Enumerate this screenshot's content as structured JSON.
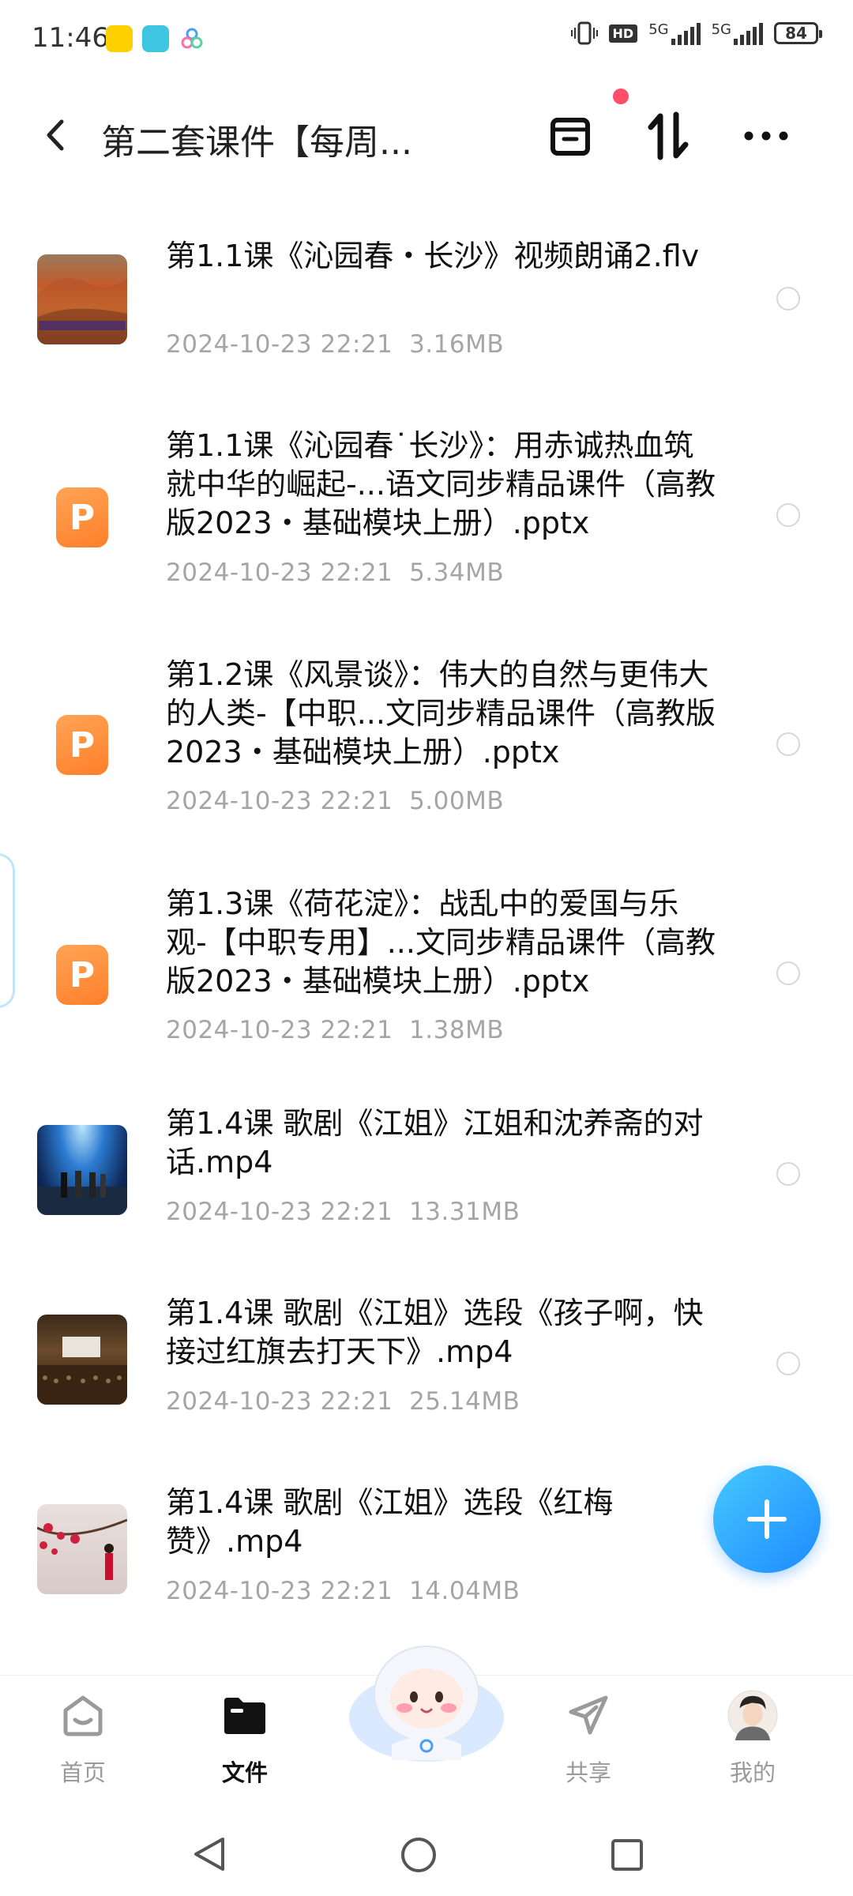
{
  "status_bar": {
    "time": "11:46",
    "network_1": "5G",
    "network_2": "5G",
    "hd_label": "HD",
    "battery": "84"
  },
  "header": {
    "title": "第二套课件【每周..."
  },
  "files": [
    {
      "name": "第1.1课《沁园春・长沙》视频朗诵2.flv",
      "date": "2024-10-23  22:21",
      "size": "3.16MB",
      "type": "video"
    },
    {
      "name": "第1.1课《沁园春˙长沙》：用赤诚热血筑就中华的崛起-...语文同步精品课件（高教版2023・基础模块上册）.pptx",
      "date": "2024-10-23  22:21",
      "size": "5.34MB",
      "type": "pptx",
      "icon_letter": "P"
    },
    {
      "name": "第1.2课《风景谈》：伟大的自然与更伟大的人类-【中职...文同步精品课件（高教版2023・基础模块上册）.pptx",
      "date": "2024-10-23  22:21",
      "size": "5.00MB",
      "type": "pptx",
      "icon_letter": "P"
    },
    {
      "name": "第1.3课《荷花淀》：战乱中的爱国与乐观-【中职专用】...文同步精品课件（高教版2023・基础模块上册）.pptx",
      "date": "2024-10-23  22:21",
      "size": "1.38MB",
      "type": "pptx",
      "icon_letter": "P"
    },
    {
      "name": "第1.4课 歌剧《江姐》江姐和沈养斋的对话.mp4",
      "date": "2024-10-23  22:21",
      "size": "13.31MB",
      "type": "video"
    },
    {
      "name": "第1.4课 歌剧《江姐》选段《孩子啊，快接过红旗去打天下》.mp4",
      "date": "2024-10-23  22:21",
      "size": "25.14MB",
      "type": "video"
    },
    {
      "name": "第1.4课 歌剧《江姐》选段《红梅赞》.mp4",
      "date": "2024-10-23  22:21",
      "size": "14.04MB",
      "type": "video"
    }
  ],
  "bottom_nav": {
    "home": "首页",
    "files": "文件",
    "share": "共享",
    "mine": "我的"
  },
  "colors": {
    "accent": "#1e8bff",
    "pptx_orange": "#ff8a33",
    "notification_dot": "#ff4d6a",
    "meta_gray": "#a5a5a5"
  },
  "icons": [
    "back-icon",
    "inbox-icon",
    "sort-icon",
    "more-icon",
    "add-icon",
    "home-icon",
    "folder-icon",
    "share-icon",
    "avatar",
    "triangle-back-icon",
    "circle-home-icon",
    "square-recents-icon"
  ]
}
